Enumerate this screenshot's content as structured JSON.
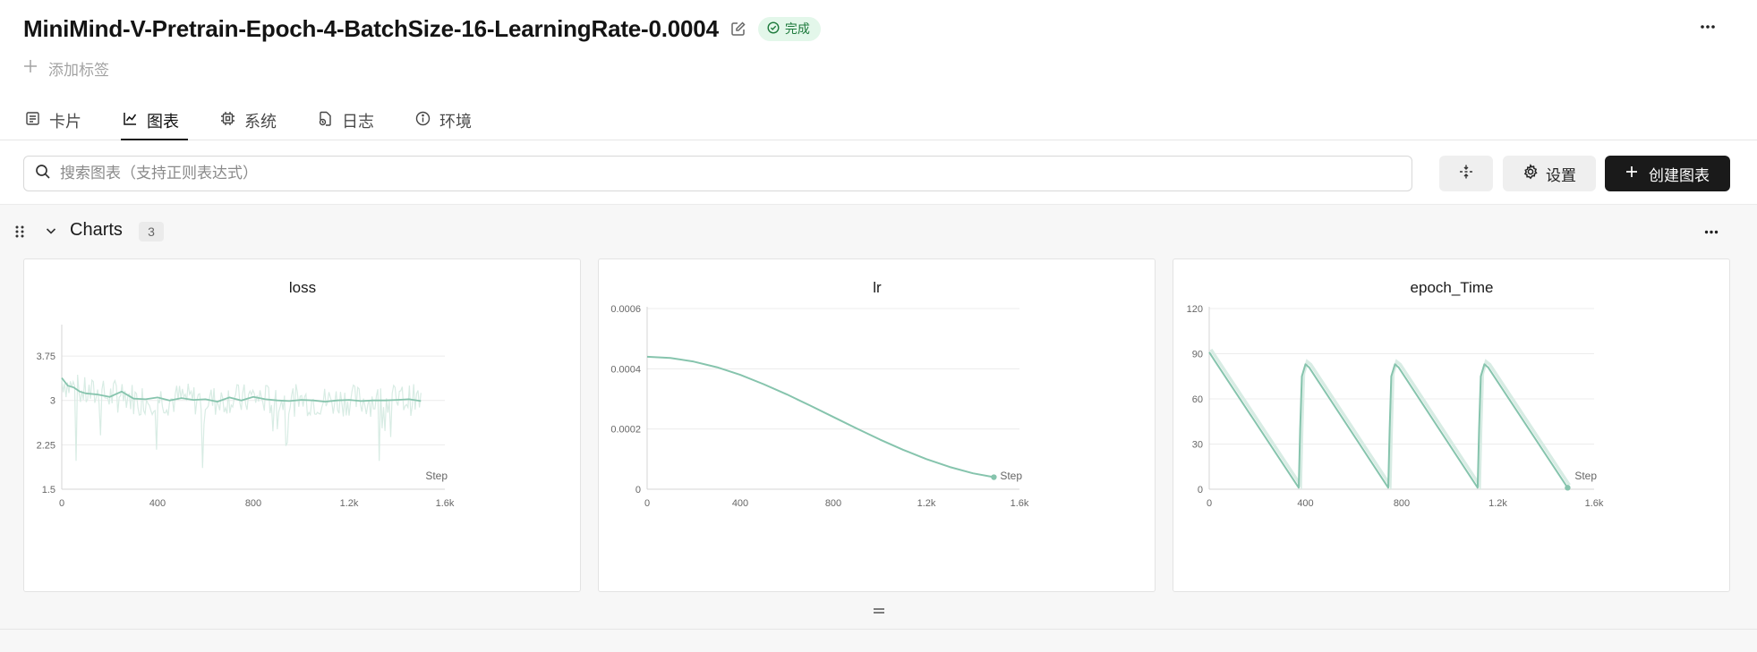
{
  "header": {
    "title": "MiniMind-V-Pretrain-Epoch-4-BatchSize-16-LearningRate-0.0004",
    "status": "完成",
    "add_tag": "添加标签"
  },
  "tabs": [
    {
      "label": "卡片",
      "icon": "card-icon"
    },
    {
      "label": "图表",
      "icon": "line-chart-icon",
      "active": true
    },
    {
      "label": "系统",
      "icon": "chip-icon"
    },
    {
      "label": "日志",
      "icon": "log-icon"
    },
    {
      "label": "环境",
      "icon": "info-icon"
    }
  ],
  "toolbar": {
    "search_placeholder": "搜索图表（支持正则表达式）",
    "settings_label": "设置",
    "create_label": "创建图表"
  },
  "section": {
    "title": "Charts",
    "count": "3"
  },
  "colors": {
    "series": "#86c4ad",
    "series_light": "#d8ece4",
    "grid": "#ececec",
    "axis_text": "#666666",
    "status_bg": "#e3f7ea",
    "status_text": "#1d7a3c"
  },
  "chart_data": [
    {
      "type": "line",
      "title": "loss",
      "xlabel": "Step",
      "xlim": [
        0,
        1600
      ],
      "ylim": [
        1.5,
        4.25
      ],
      "xticks": [
        0,
        400,
        800,
        1200,
        1600
      ],
      "xtick_labels": [
        "0",
        "400",
        "800",
        "1.2k",
        "1.6k"
      ],
      "yticks": [
        1.5,
        2.25,
        3,
        3.75
      ],
      "ytick_labels": [
        "1.5",
        "2.25",
        "3",
        "3.75"
      ],
      "grid": true,
      "series": [
        {
          "x": [
            0,
            25,
            50,
            75,
            100,
            150,
            200,
            250,
            300,
            350,
            400,
            450,
            500,
            550,
            600,
            650,
            700,
            750,
            800,
            850,
            900,
            950,
            1000,
            1050,
            1100,
            1150,
            1200,
            1250,
            1300,
            1350,
            1400,
            1450,
            1500
          ],
          "y": [
            3.38,
            3.25,
            3.22,
            3.15,
            3.12,
            3.1,
            3.06,
            3.15,
            3.03,
            3.02,
            3.05,
            3.0,
            3.04,
            3.01,
            3.02,
            2.98,
            3.05,
            3.0,
            3.06,
            3.02,
            3.0,
            2.99,
            3.01,
            3.0,
            2.98,
            3.0,
            3.01,
            2.99,
            3.0,
            3.0,
            3.01,
            3.02,
            2.99
          ]
        }
      ]
    },
    {
      "type": "line",
      "title": "lr",
      "xlabel": "Step",
      "xlim": [
        0,
        1600
      ],
      "ylim": [
        0,
        0.0006
      ],
      "xticks": [
        0,
        400,
        800,
        1200,
        1600
      ],
      "xtick_labels": [
        "0",
        "400",
        "800",
        "1.2k",
        "1.6k"
      ],
      "yticks": [
        0,
        0.0002,
        0.0004,
        0.0006
      ],
      "ytick_labels": [
        "0",
        "0.0002",
        "0.0004",
        "0.0006"
      ],
      "grid": true,
      "series": [
        {
          "x": [
            0,
            100,
            200,
            300,
            400,
            500,
            600,
            700,
            800,
            900,
            1000,
            1100,
            1200,
            1300,
            1400,
            1490
          ],
          "y": [
            0.00044,
            0.000436,
            0.000424,
            0.000405,
            0.00038,
            0.000349,
            0.000315,
            0.000278,
            0.00024,
            0.000202,
            0.000165,
            0.000131,
            0.0001,
            7.4e-05,
            5.3e-05,
            4e-05
          ]
        }
      ]
    },
    {
      "type": "line",
      "title": "epoch_Time",
      "xlabel": "Step",
      "xlim": [
        0,
        1600
      ],
      "ylim": [
        0,
        120
      ],
      "xticks": [
        0,
        400,
        800,
        1200,
        1600
      ],
      "xtick_labels": [
        "0",
        "400",
        "800",
        "1.2k",
        "1.6k"
      ],
      "yticks": [
        0,
        30,
        60,
        90,
        120
      ],
      "ytick_labels": [
        "0",
        "30",
        "60",
        "90",
        "120"
      ],
      "grid": true,
      "series": [
        {
          "x": [
            0,
            20,
            372,
            378,
            385,
            400,
            415,
            744,
            750,
            757,
            772,
            787,
            1116,
            1122,
            1129,
            1144,
            1159,
            1490
          ],
          "y": [
            91,
            86,
            1,
            40,
            75,
            83,
            81,
            1,
            40,
            75,
            83,
            81,
            1,
            40,
            75,
            83,
            81,
            1
          ]
        }
      ]
    }
  ]
}
